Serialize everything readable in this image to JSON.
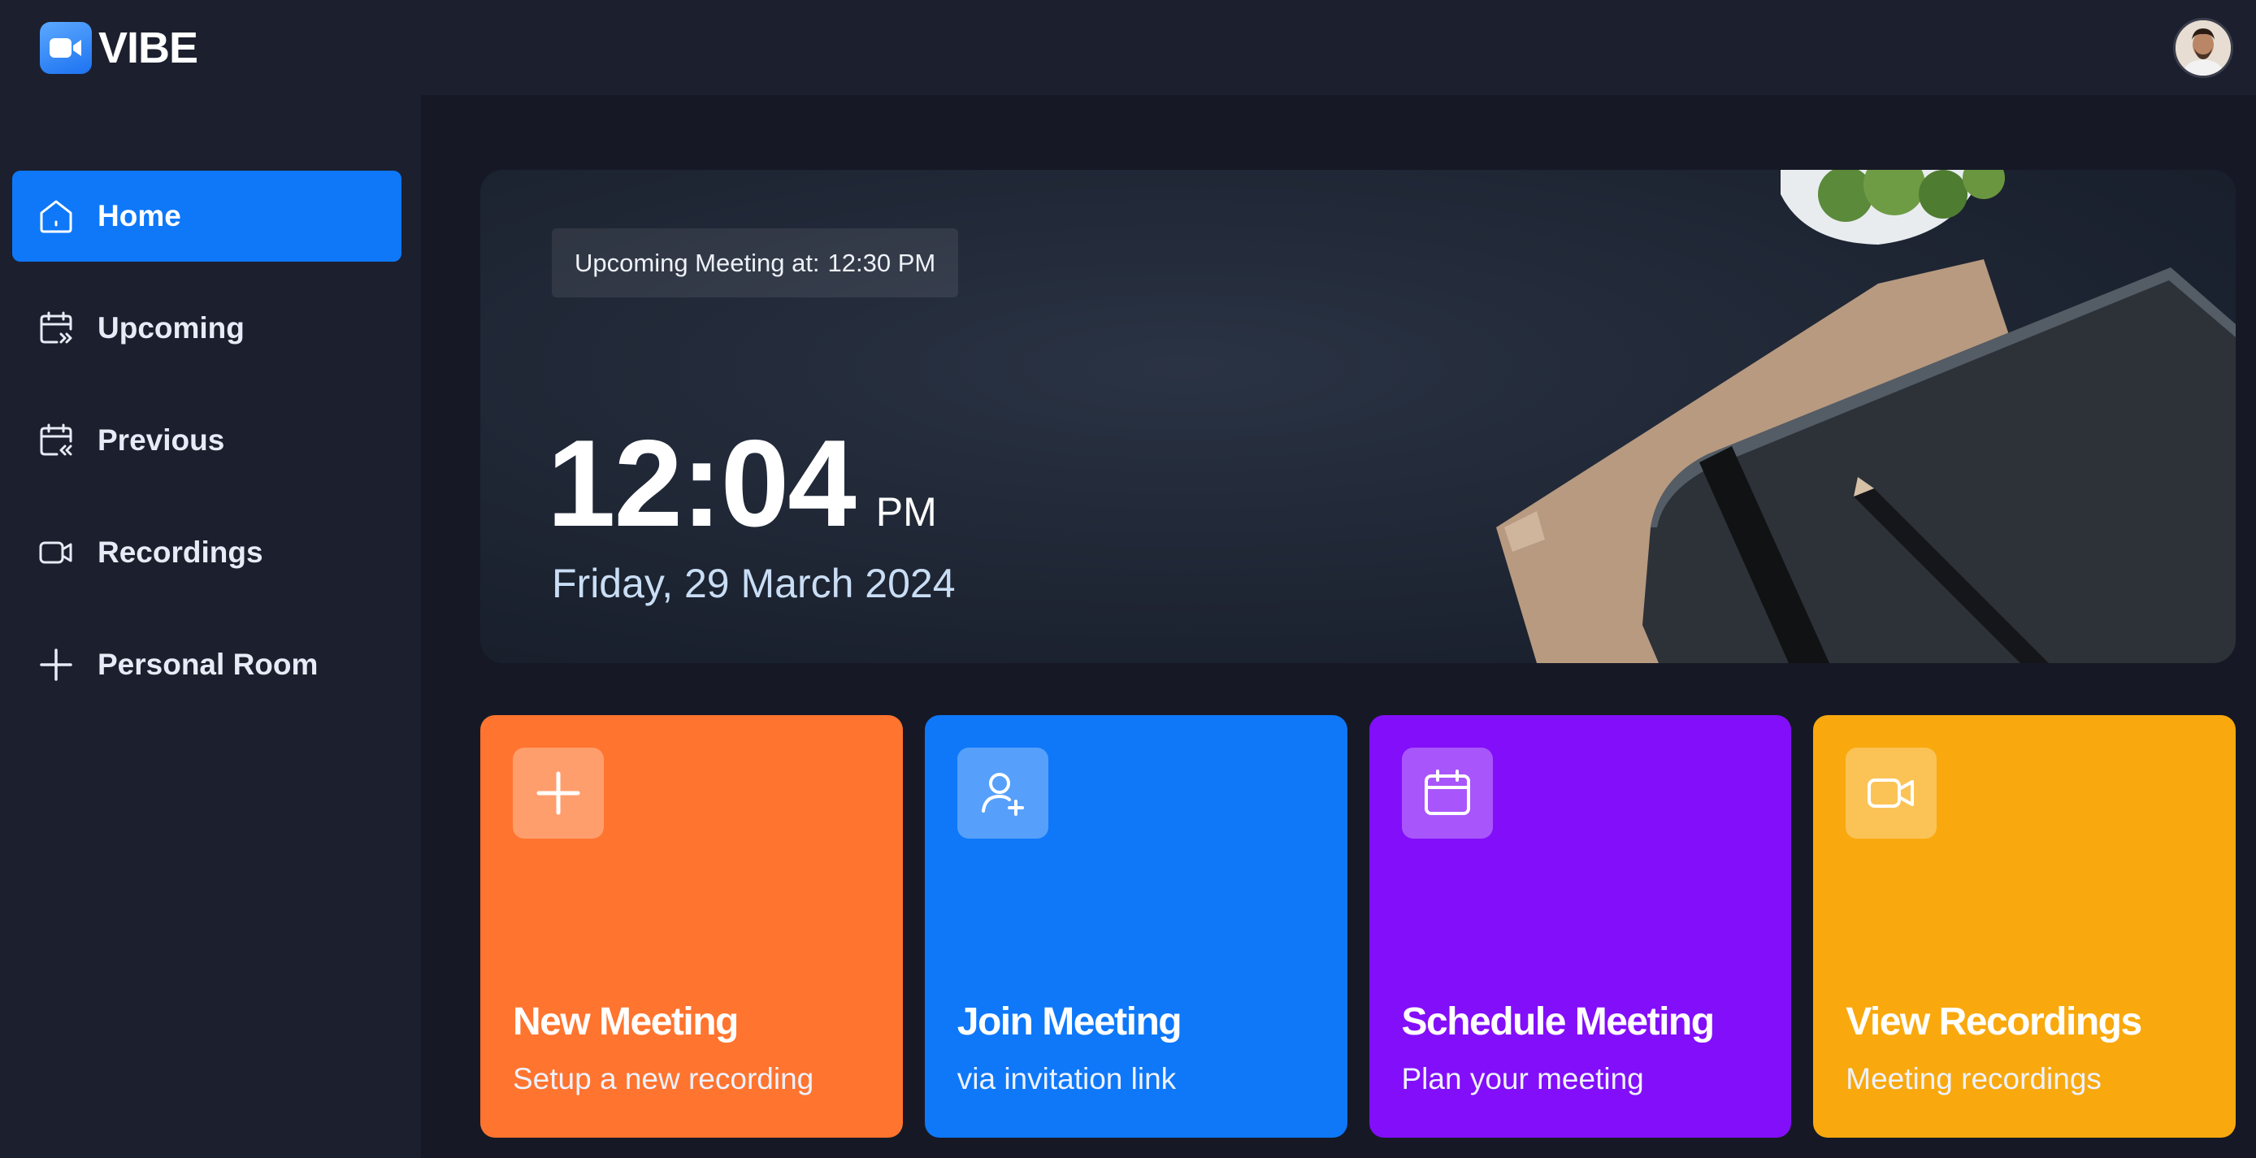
{
  "brand": {
    "name": "VIBE",
    "icon": "video-camera-icon"
  },
  "user": {
    "avatar": "user-avatar"
  },
  "sidebar": {
    "items": [
      {
        "label": "Home",
        "icon": "home-icon",
        "active": true
      },
      {
        "label": "Upcoming",
        "icon": "calendar-forward-icon",
        "active": false
      },
      {
        "label": "Previous",
        "icon": "calendar-back-icon",
        "active": false
      },
      {
        "label": "Recordings",
        "icon": "video-icon",
        "active": false
      },
      {
        "label": "Personal Room",
        "icon": "plus-icon",
        "active": false
      }
    ]
  },
  "hero": {
    "upcoming_label": "Upcoming Meeting at:",
    "upcoming_time": "12:30 PM",
    "time": "12:04",
    "ampm": "PM",
    "date": "Friday, 29 March 2024"
  },
  "cards": [
    {
      "title": "New Meeting",
      "subtitle": "Setup a new recording",
      "icon": "plus-icon",
      "color": "#ff742e"
    },
    {
      "title": "Join Meeting",
      "subtitle": "via invitation link",
      "icon": "user-add-icon",
      "color": "#0e78f9"
    },
    {
      "title": "Schedule Meeting",
      "subtitle": "Plan your meeting",
      "icon": "calendar-icon",
      "color": "#830ef9"
    },
    {
      "title": "View Recordings",
      "subtitle": "Meeting recordings",
      "icon": "video-icon",
      "color": "#f9a90e"
    }
  ],
  "colors": {
    "background": "#161925",
    "panel": "#1c1f2e",
    "accent": "#0e78f9"
  }
}
